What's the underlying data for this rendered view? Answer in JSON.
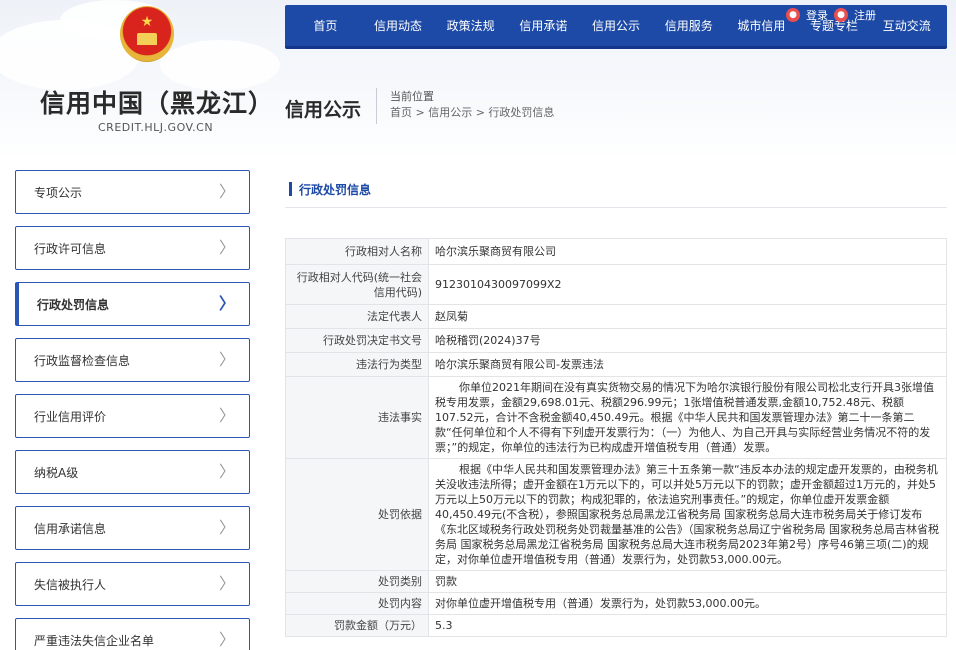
{
  "site": {
    "title": "信用中国（黑龙江）",
    "url": "CREDIT.HLJ.GOV.CN",
    "section_title": "信用公示"
  },
  "breadcrumb": {
    "label": "当前位置",
    "path": "首页 > 信用公示 > 行政处罚信息"
  },
  "nav": {
    "items": [
      "首页",
      "信用动态",
      "政策法规",
      "信用承诺",
      "信用公示",
      "信用服务",
      "城市信用",
      "专题专栏",
      "互动交流"
    ]
  },
  "account": {
    "login": "登录",
    "register": "注册"
  },
  "sidebar": {
    "items": [
      {
        "label": "专项公示",
        "active": false
      },
      {
        "label": "行政许可信息",
        "active": false
      },
      {
        "label": "行政处罚信息",
        "active": true
      },
      {
        "label": "行政监督检查信息",
        "active": false
      },
      {
        "label": "行业信用评价",
        "active": false
      },
      {
        "label": "纳税A级",
        "active": false
      },
      {
        "label": "信用承诺信息",
        "active": false
      },
      {
        "label": "失信被执行人",
        "active": false
      },
      {
        "label": "严重违法失信企业名单",
        "active": false
      }
    ]
  },
  "panel": {
    "title": "行政处罚信息"
  },
  "record": {
    "rows": [
      {
        "key": "行政相对人名称",
        "value": "哈尔滨乐聚商贸有限公司"
      },
      {
        "key": "行政相对人代码(统一社会信用代码)",
        "value": "9123010430097099X2"
      },
      {
        "key": "法定代表人",
        "value": "赵凤菊"
      },
      {
        "key": "行政处罚决定书文号",
        "value": "哈税稽罚(2024)37号"
      },
      {
        "key": "违法行为类型",
        "value": "哈尔滨乐聚商贸有限公司-发票违法"
      },
      {
        "key": "违法事实",
        "value": "你单位2021年期间在没有真实货物交易的情况下为哈尔滨银行股份有限公司松北支行开具3张增值税专用发票，金额29,698.01元、税额296.99元；1张增值税普通发票,金额10,752.48元、税额107.52元，合计不含税金额40,450.49元。根据《中华人民共和国发票管理办法》第二十一条第二款“任何单位和个人不得有下列虚开发票行为：（一）为他人、为自己开具与实际经营业务情况不符的发票；”的规定，你单位的违法行为已构成虚开增值税专用（普通）发票。"
      },
      {
        "key": "处罚依据",
        "value": "根据《中华人民共和国发票管理办法》第三十五条第一款“违反本办法的规定虚开发票的，由税务机关没收违法所得；虚开金额在1万元以下的，可以并处5万元以下的罚款；虚开金额超过1万元的，并处5万元以上50万元以下的罚款；构成犯罪的，依法追究刑事责任。”的规定，你单位虚开发票金额40,450.49元(不含税），参照国家税务总局黑龙江省税务局 国家税务总局大连市税务局关于修订发布《东北区域税务行政处罚税务处罚裁量基准的公告》（国家税务总局辽宁省税务局 国家税务总局吉林省税务局 国家税务总局黑龙江省税务局 国家税务总局大连市税务局2023年第2号）序号46第三项(二)的规定，对你单位虚开增值税专用（普通）发票行为，处罚款53,000.00元。"
      },
      {
        "key": "处罚类别",
        "value": "罚款"
      },
      {
        "key": "处罚内容",
        "value": "对你单位虚开增值税专用（普通）发票行为，处罚款53,000.00元。"
      },
      {
        "key": "罚款金额（万元）",
        "value": "5.3"
      }
    ]
  }
}
